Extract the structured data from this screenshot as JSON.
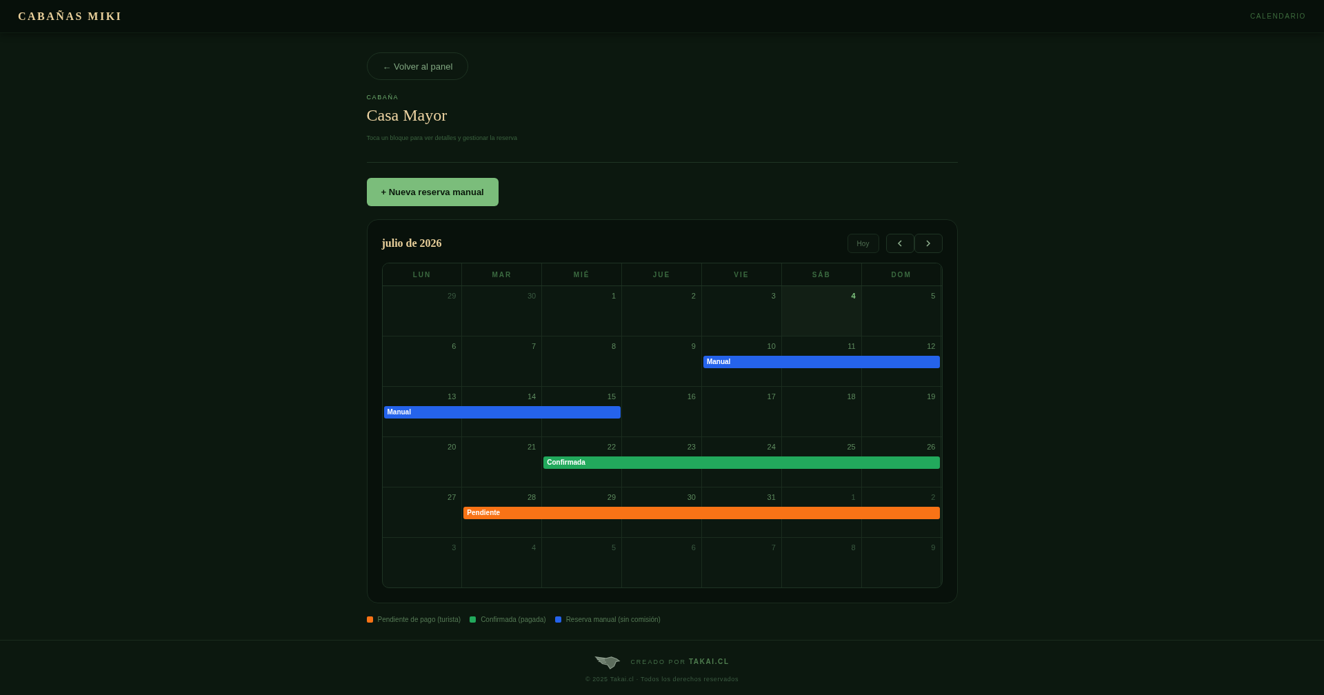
{
  "header": {
    "brand": "CABAÑAS MIKI",
    "nav": "CALENDARIO"
  },
  "back_button": "← Volver al panel",
  "eyebrow": "CABAÑA",
  "title": "Casa Mayor",
  "subtitle": "Toca un bloque para ver detalles y gestionar la reserva",
  "new_button": "+ Nueva reserva manual",
  "calendar": {
    "month": "julio de 2026",
    "today_button": "Hoy",
    "weekdays": [
      "LUN",
      "MAR",
      "MIÉ",
      "JUE",
      "VIE",
      "SÁB",
      "DOM"
    ],
    "weeks": [
      {
        "days": [
          {
            "label": "29",
            "outside": true,
            "today": false
          },
          {
            "label": "30",
            "outside": true,
            "today": false
          },
          {
            "label": "1",
            "outside": false,
            "today": false
          },
          {
            "label": "2",
            "outside": false,
            "today": false
          },
          {
            "label": "3",
            "outside": false,
            "today": false
          },
          {
            "label": "4",
            "outside": false,
            "today": true
          },
          {
            "label": "5",
            "outside": false,
            "today": false
          }
        ]
      },
      {
        "days": [
          {
            "label": "6",
            "outside": false,
            "today": false,
            "booked": false
          },
          {
            "label": "7",
            "outside": false,
            "today": false,
            "booked": false
          },
          {
            "label": "8",
            "outside": false,
            "today": false,
            "booked": false
          },
          {
            "label": "9",
            "outside": false,
            "today": false,
            "booked": false
          },
          {
            "label": "10",
            "outside": false,
            "today": false,
            "booked": true
          },
          {
            "label": "11",
            "outside": false,
            "today": false,
            "booked": true
          },
          {
            "label": "12",
            "outside": false,
            "today": false,
            "booked": true
          }
        ],
        "event": {
          "label": "Manual",
          "color": "#2563eb"
        }
      },
      {
        "days": [
          {
            "label": "13",
            "outside": false,
            "today": false,
            "booked": true
          },
          {
            "label": "14",
            "outside": false,
            "today": false,
            "booked": true
          },
          {
            "label": "15",
            "outside": false,
            "today": false,
            "booked": true
          },
          {
            "label": "16",
            "outside": false,
            "today": false,
            "booked": false
          },
          {
            "label": "17",
            "outside": false,
            "today": false,
            "booked": false
          },
          {
            "label": "18",
            "outside": false,
            "today": false,
            "booked": false
          },
          {
            "label": "19",
            "outside": false,
            "today": false,
            "booked": false
          }
        ],
        "event": {
          "label": "Manual",
          "color": "#2563eb"
        }
      },
      {
        "days": [
          {
            "label": "20",
            "outside": false,
            "today": false,
            "booked": false
          },
          {
            "label": "21",
            "outside": false,
            "today": false,
            "booked": false
          },
          {
            "label": "22",
            "outside": false,
            "today": false,
            "booked": true
          },
          {
            "label": "23",
            "outside": false,
            "today": false,
            "booked": true
          },
          {
            "label": "24",
            "outside": false,
            "today": false,
            "booked": true
          },
          {
            "label": "25",
            "outside": false,
            "today": false,
            "booked": true
          },
          {
            "label": "26",
            "outside": false,
            "today": false,
            "booked": true
          }
        ],
        "event": {
          "label": "Confirmada",
          "color": "#22a95c"
        }
      },
      {
        "days": [
          {
            "label": "27",
            "outside": false,
            "today": false,
            "booked": false
          },
          {
            "label": "28",
            "outside": false,
            "today": false,
            "booked": true
          },
          {
            "label": "29",
            "outside": false,
            "today": false,
            "booked": true
          },
          {
            "label": "30",
            "outside": false,
            "today": false,
            "booked": true
          },
          {
            "label": "31",
            "outside": false,
            "today": false,
            "booked": true
          },
          {
            "label": "1",
            "outside": true,
            "today": false,
            "booked": true
          },
          {
            "label": "2",
            "outside": true,
            "today": false,
            "booked": true
          }
        ],
        "event": {
          "label": "Pendiente",
          "color": "#f97316"
        }
      },
      {
        "days": [
          {
            "label": "3",
            "outside": true,
            "today": false
          },
          {
            "label": "4",
            "outside": true,
            "today": false
          },
          {
            "label": "5",
            "outside": true,
            "today": false
          },
          {
            "label": "6",
            "outside": true,
            "today": false
          },
          {
            "label": "7",
            "outside": true,
            "today": false
          },
          {
            "label": "8",
            "outside": true,
            "today": false
          },
          {
            "label": "9",
            "outside": true,
            "today": false
          }
        ]
      }
    ]
  },
  "legend": [
    {
      "label": "Pendiente de pago (turista)",
      "color": "#f97316"
    },
    {
      "label": "Confirmada (pagada)",
      "color": "#22a95c"
    },
    {
      "label": "Reserva manual (sin comisión)",
      "color": "#2563eb"
    }
  ],
  "footer": {
    "credit": "CREADO POR",
    "brand": "TAKAI.CL",
    "copyright": "© 2025 Takai.cl · Todos los derechos reservados"
  }
}
